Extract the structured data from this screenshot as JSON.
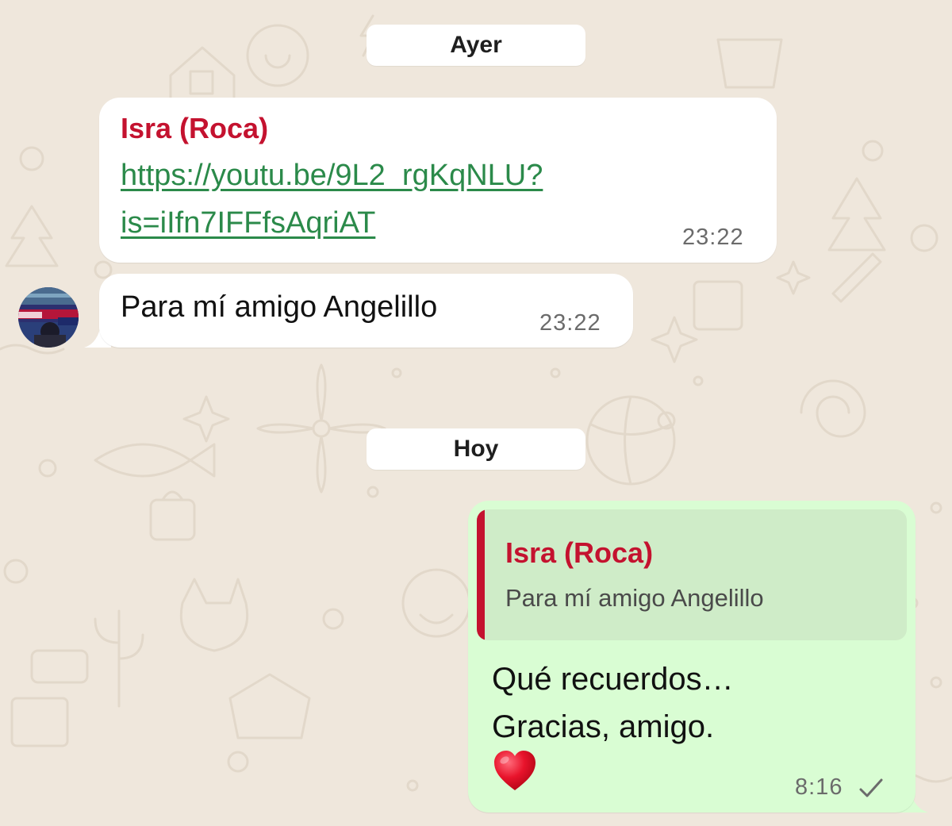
{
  "colors": {
    "wallpaper": "#efe7dc",
    "incoming_bubble": "#ffffff",
    "outgoing_bubble": "#d9fdd3",
    "sender_name": "#c4122f",
    "link": "#2b8a4a",
    "timestamp": "#6b6b6b"
  },
  "dividers": {
    "yesterday": "Ayer",
    "today": "Hoy"
  },
  "messages": [
    {
      "sender": "Isra (Roca)",
      "link_line1": "https://youtu.be/9L2_rgKqNLU?",
      "link_line2": "is=iIfn7IFFfsAqriAT",
      "time": "23:22"
    },
    {
      "text": "Para mí amigo Angelillo",
      "time": "23:22",
      "avatar_icon": "contact-avatar"
    }
  ],
  "reply": {
    "quote_sender": "Isra (Roca)",
    "quote_text": "Para mí amigo Angelillo",
    "line1": "Qué recuerdos…",
    "line2": "Gracias, amigo.",
    "emoji": "❤️",
    "time": "8:16",
    "status_icon": "single-check-icon"
  }
}
